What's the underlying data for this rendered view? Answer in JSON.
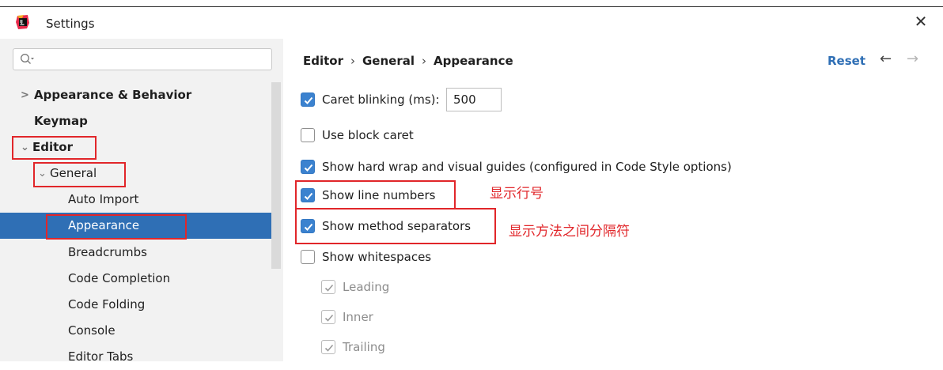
{
  "window": {
    "title": "Settings"
  },
  "search": {
    "placeholder": "",
    "value": ""
  },
  "sidebar": {
    "items": [
      {
        "label": "Appearance & Behavior",
        "bold": true
      },
      {
        "label": "Keymap",
        "bold": true
      },
      {
        "label": "Editor",
        "bold": true
      },
      {
        "label": "General",
        "bold": false
      },
      {
        "label": "Auto Import",
        "bold": false
      },
      {
        "label": "Appearance",
        "bold": false,
        "selected": true
      },
      {
        "label": "Breadcrumbs",
        "bold": false
      },
      {
        "label": "Code Completion",
        "bold": false
      },
      {
        "label": "Code Folding",
        "bold": false
      },
      {
        "label": "Console",
        "bold": false
      },
      {
        "label": "Editor Tabs",
        "bold": false
      }
    ]
  },
  "breadcrumb": [
    "Editor",
    "General",
    "Appearance"
  ],
  "header": {
    "reset_label": "Reset"
  },
  "options": {
    "caret_blinking": {
      "label": "Caret blinking (ms):",
      "checked": true,
      "value": "500"
    },
    "block_caret": {
      "label": "Use block caret",
      "checked": false
    },
    "hard_wrap": {
      "label": "Show hard wrap and visual guides (configured in Code Style options)",
      "checked": true
    },
    "line_numbers": {
      "label": "Show line numbers",
      "checked": true
    },
    "method_separators": {
      "label": "Show method separators",
      "checked": true
    },
    "whitespaces": {
      "label": "Show whitespaces",
      "checked": false
    },
    "leading": {
      "label": "Leading",
      "checked": true,
      "disabled": true
    },
    "inner": {
      "label": "Inner",
      "checked": true,
      "disabled": true
    },
    "trailing": {
      "label": "Trailing",
      "checked": true,
      "disabled": true
    }
  },
  "annotations": {
    "line_numbers_note": "显示行号",
    "method_separators_note": "显示方法之间分隔符"
  },
  "colors": {
    "accent": "#2f6fb5",
    "checkbox": "#3b82cf",
    "annotation": "#e1262a",
    "sidebar_bg": "#f2f2f2"
  },
  "icons": [
    "app-logo-icon",
    "close-icon",
    "search-icon",
    "chevron-right-icon",
    "chevron-down-icon",
    "arrow-left-icon",
    "arrow-right-icon",
    "checkmark-icon"
  ]
}
